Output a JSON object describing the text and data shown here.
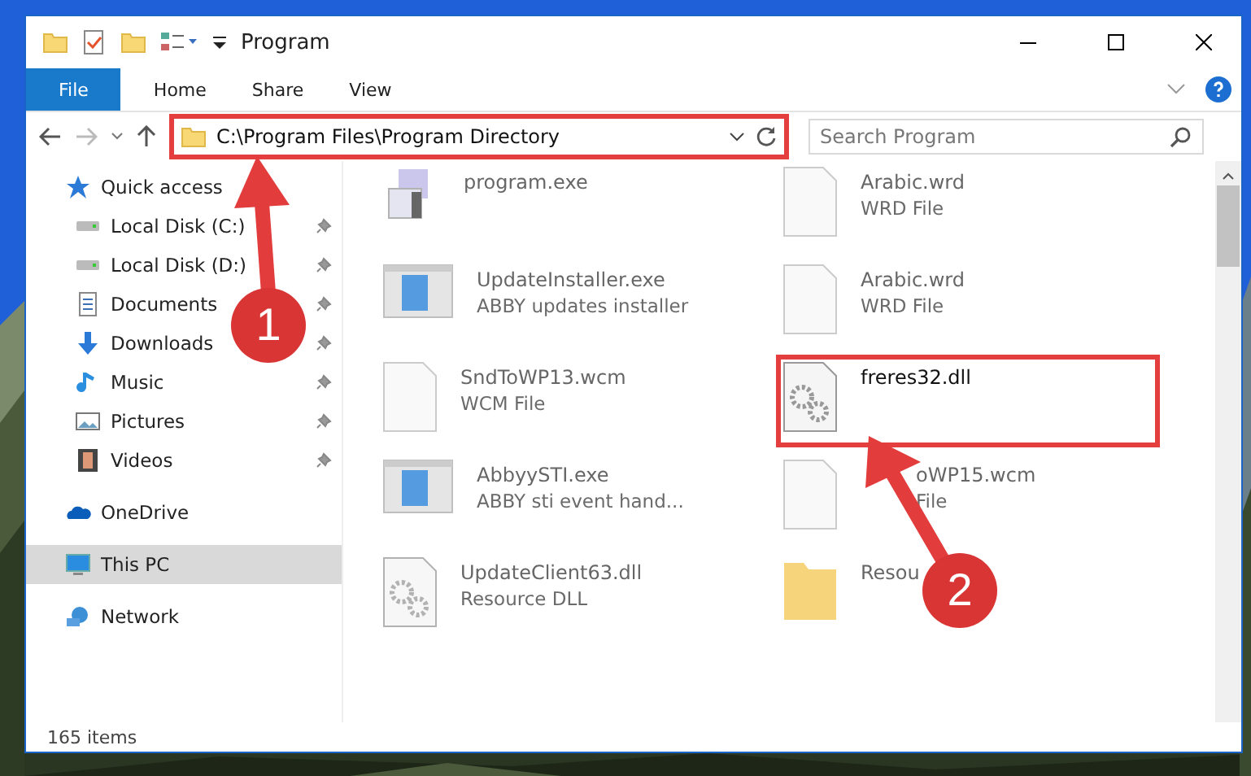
{
  "window": {
    "title": "Program"
  },
  "ribbon_tabs": [
    {
      "label": "File",
      "kind": "file"
    },
    {
      "label": "Home",
      "kind": "tab"
    },
    {
      "label": "Share",
      "kind": "tab"
    },
    {
      "label": "View",
      "kind": "tab"
    }
  ],
  "address": {
    "path": "C:\\Program Files\\Program Directory",
    "highlighted": true
  },
  "search": {
    "placeholder": "Search Program"
  },
  "sidebar": {
    "items": [
      {
        "label": "Quick access",
        "kind": "group",
        "pinned": false,
        "selected": false
      },
      {
        "label": "Local Disk (C:)",
        "kind": "child",
        "pinned": true,
        "selected": false
      },
      {
        "label": "Local Disk (D:)",
        "kind": "child",
        "pinned": true,
        "selected": false
      },
      {
        "label": "Documents",
        "kind": "child",
        "pinned": true,
        "selected": false
      },
      {
        "label": "Downloads",
        "kind": "child",
        "pinned": true,
        "selected": false
      },
      {
        "label": "Music",
        "kind": "child",
        "pinned": true,
        "selected": false
      },
      {
        "label": "Pictures",
        "kind": "child",
        "pinned": true,
        "selected": false
      },
      {
        "label": "Videos",
        "kind": "child",
        "pinned": true,
        "selected": false
      },
      {
        "label": "OneDrive",
        "kind": "group",
        "pinned": false,
        "selected": false
      },
      {
        "label": "This PC",
        "kind": "group",
        "pinned": false,
        "selected": true
      },
      {
        "label": "Network",
        "kind": "group",
        "pinned": false,
        "selected": false
      }
    ]
  },
  "files": [
    {
      "name": "program.exe",
      "kind": "installer",
      "blurred": true,
      "highlighted": false,
      "covered": false
    },
    {
      "name": "Arabic.wrd",
      "type": "WRD File",
      "kind": "blank",
      "blurred": true,
      "highlighted": false,
      "covered": false
    },
    {
      "name": "UpdateInstaller.exe",
      "type": "ABBY updates installer",
      "kind": "app",
      "blurred": true,
      "highlighted": false,
      "covered": false
    },
    {
      "name": "Arabic.wrd",
      "type": "WRD File",
      "kind": "blank",
      "blurred": true,
      "highlighted": false,
      "covered": false
    },
    {
      "name": "SndToWP13.wcm",
      "type": "WCM File",
      "kind": "blank",
      "blurred": true,
      "highlighted": false,
      "covered": false
    },
    {
      "name": "freres32.dll",
      "kind": "dll",
      "blurred": false,
      "highlighted": true,
      "covered": false
    },
    {
      "name": "AbbyySTI.exe",
      "type": "ABBY sti event hand...",
      "kind": "app",
      "blurred": true,
      "highlighted": false,
      "covered": false
    },
    {
      "name": "oWP15.wcm",
      "type": "File",
      "kind": "blank",
      "blurred": true,
      "highlighted": false,
      "covered": true
    },
    {
      "name": "UpdateClient63.dll",
      "type": "Resource DLL",
      "kind": "dll",
      "blurred": true,
      "highlighted": false,
      "covered": false
    },
    {
      "name": "Resou",
      "kind": "folder",
      "blurred": true,
      "highlighted": false,
      "covered": false
    }
  ],
  "annotations": [
    {
      "number": "1"
    },
    {
      "number": "2"
    }
  ],
  "status_bar": {
    "count": "165 items"
  }
}
